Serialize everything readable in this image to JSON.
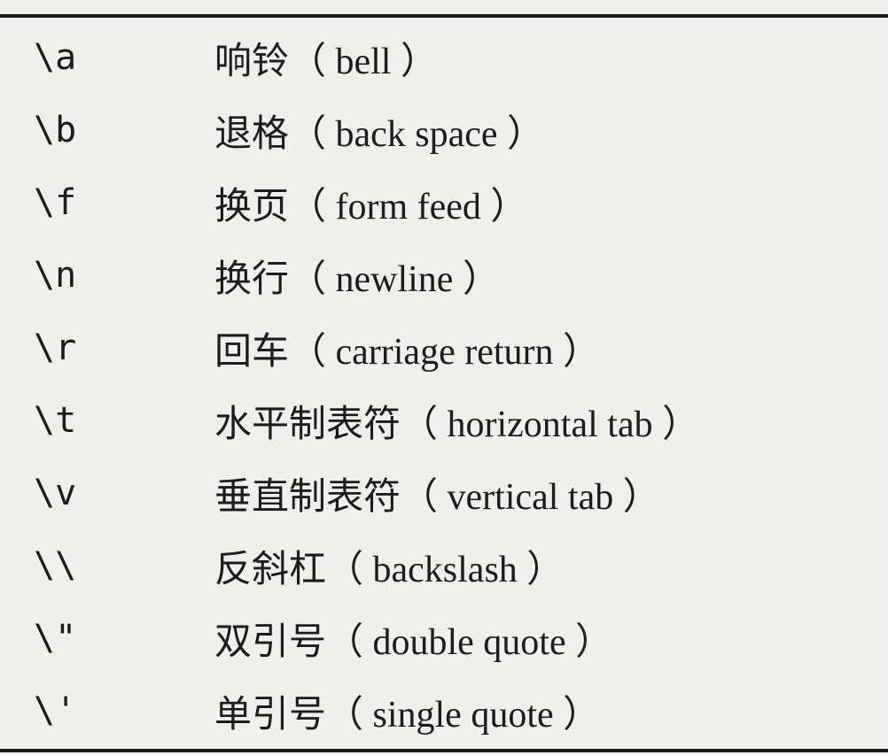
{
  "rows": [
    {
      "code": "\\a",
      "desc": "响铃（ bell ）"
    },
    {
      "code": "\\b",
      "desc": "退格（ back space ）"
    },
    {
      "code": "\\f",
      "desc": "换页（ form feed ）"
    },
    {
      "code": "\\n",
      "desc": "换行（ newline ）"
    },
    {
      "code": "\\r",
      "desc": "回车（ carriage return ）"
    },
    {
      "code": "\\t",
      "desc": "水平制表符（ horizontal tab ）"
    },
    {
      "code": "\\v",
      "desc": "垂直制表符（ vertical tab ）"
    },
    {
      "code": "\\\\",
      "desc": "反斜杠（ backslash ）"
    },
    {
      "code": "\\\"",
      "desc": "双引号（ double quote ）"
    },
    {
      "code": "\\'",
      "desc": "单引号（ single quote ）"
    }
  ]
}
